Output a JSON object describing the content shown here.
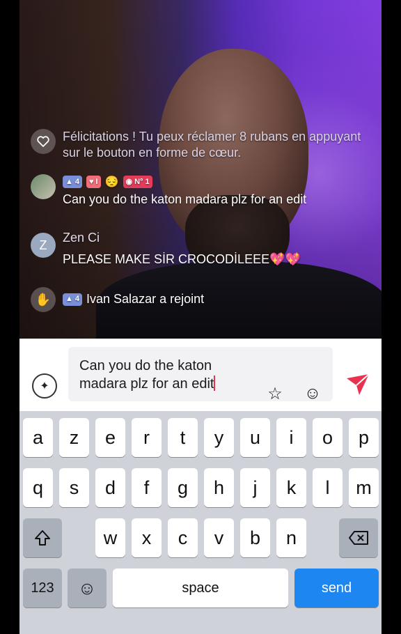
{
  "chat": {
    "messages": [
      {
        "type": "system",
        "text": "Félicitations ! Tu peux réclamer 8 rubans en appuyant sur le bouton en forme de cœur."
      },
      {
        "type": "user",
        "badges": {
          "level": "4",
          "fan": "I",
          "rank": "N° 1"
        },
        "text": "Can you do the katon madara plz for an edit"
      },
      {
        "type": "user",
        "avatar_letter": "Z",
        "name": "Zen Ci",
        "text": "PLEASE MAKE SİR CROCODİLEEE💖💖"
      },
      {
        "type": "join",
        "level": "4",
        "text": "Ivan Salazar a rejoint"
      }
    ]
  },
  "input": {
    "value": "Can you do the katon madara plz for an edit",
    "accent": "#e8324f"
  },
  "keyboard": {
    "row1": [
      "a",
      "z",
      "e",
      "r",
      "t",
      "y",
      "u",
      "i",
      "o",
      "p"
    ],
    "row2": [
      "q",
      "s",
      "d",
      "f",
      "g",
      "h",
      "j",
      "k",
      "l",
      "m"
    ],
    "row3": [
      "w",
      "x",
      "c",
      "v",
      "b",
      "n"
    ],
    "numbers_label": "123",
    "space_label": "space",
    "send_label": "send",
    "send_color": "#1e86f0"
  }
}
